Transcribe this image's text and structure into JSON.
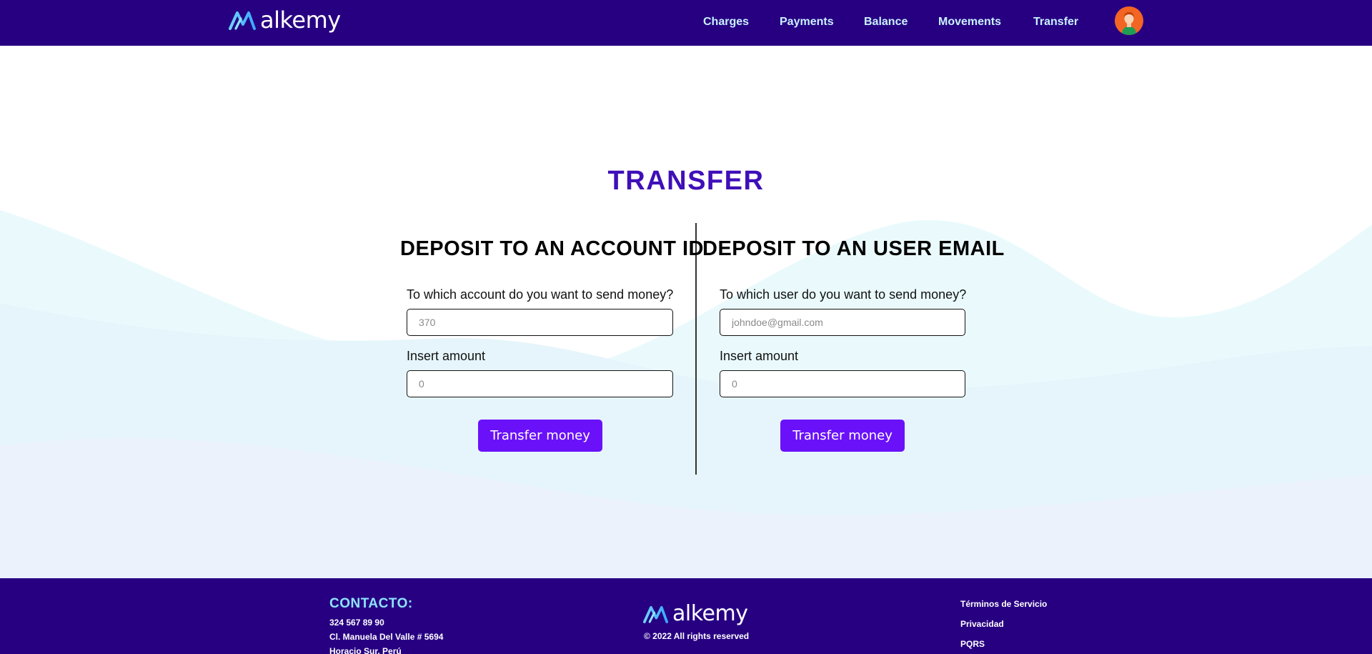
{
  "brand": {
    "name": "alkemy"
  },
  "nav": {
    "items": [
      {
        "label": "Charges"
      },
      {
        "label": "Payments"
      },
      {
        "label": "Balance"
      },
      {
        "label": "Movements"
      },
      {
        "label": "Transfer"
      }
    ]
  },
  "page": {
    "title": "TRANSFER"
  },
  "account_section": {
    "title": "DEPOSIT TO AN ACCOUNT ID",
    "target_label": "To which account do you want to send money?",
    "target_placeholder": "370",
    "amount_label": "Insert amount",
    "amount_placeholder": "0",
    "button_label": "Transfer money"
  },
  "email_section": {
    "title": "DEPOSIT TO AN USER EMAIL",
    "target_label": "To which user do you want to send money?",
    "target_placeholder": "johndoe@gmail.com",
    "amount_label": "Insert amount",
    "amount_placeholder": "0",
    "button_label": "Transfer money"
  },
  "footer": {
    "contact_title": "CONTACTO:",
    "contact_lines": [
      "324 567 89 90",
      "Cl. Manuela Del Valle # 5694",
      "Horacio Sur, Perú"
    ],
    "copyright": "© 2022 All rights reserved",
    "links": [
      {
        "label": "Términos de Servicio"
      },
      {
        "label": "Privacidad"
      },
      {
        "label": "PQRS"
      }
    ]
  },
  "colors": {
    "header_bg": "#270082",
    "nav_text": "#c9f1ff",
    "title": "#3f0fb8",
    "button": "#6a11fa",
    "contact_title": "#8fe3ff"
  },
  "icons": {
    "logo": "alkemy-logo-mark",
    "avatar": "user-avatar"
  }
}
